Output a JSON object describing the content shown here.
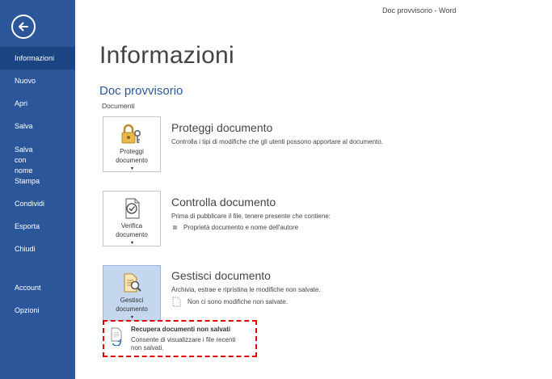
{
  "window_title": "Doc provvisorio - Word",
  "sidebar": {
    "back_icon": "back-arrow-icon",
    "items": [
      {
        "label": "Informazioni",
        "active": true
      },
      {
        "label": "Nuovo"
      },
      {
        "label": "Apri"
      },
      {
        "label": "Salva"
      },
      {
        "label": "Salva con nome"
      },
      {
        "label": "Stampa"
      },
      {
        "label": "Condividi"
      },
      {
        "label": "Esporta"
      },
      {
        "label": "Chiudi"
      },
      {
        "label": "Account"
      },
      {
        "label": "Opzioni"
      }
    ],
    "colors": {
      "background": "#2b579a",
      "active": "#1a4582"
    }
  },
  "main": {
    "title": "Informazioni",
    "doc_name": "Doc provvisorio",
    "doc_location": "Documenti",
    "sections": [
      {
        "button_line1": "Proteggi",
        "button_line2": "documento",
        "icon": "lock-key-icon",
        "title": "Proteggi documento",
        "description": "Controlla i tipi di modifiche che gli utenti possono apportare al documento."
      },
      {
        "button_line1": "Verifica",
        "button_line2": "documento",
        "icon": "document-check-icon",
        "title": "Controlla documento",
        "description": "Prima di pubblicare il file, tenere presente che contiene:",
        "bullet": "Proprietà documento e nome dell'autore"
      },
      {
        "button_line1": "Gestisci",
        "button_line2": "documento",
        "icon": "document-search-icon",
        "title": "Gestisci documento",
        "description": "Archivia, estrae e ripristina le modifiche non salvate.",
        "note": "Non ci sono modifiche non salvate."
      }
    ],
    "recover": {
      "title": "Recupera documenti non salvati",
      "description": "Consente di visualizzare i file recenti non salvati.",
      "icon": "recover-document-icon",
      "highlight_color": "#e00000"
    }
  }
}
